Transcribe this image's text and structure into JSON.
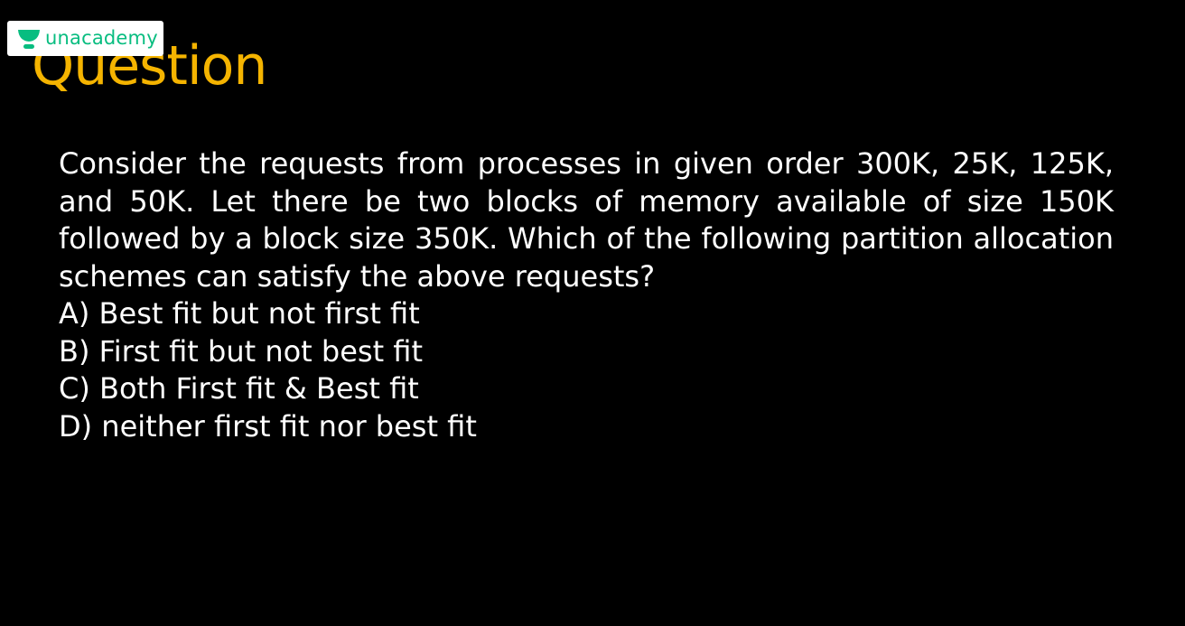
{
  "brand": {
    "logo_text": "unacademy",
    "logo_icon": "unacademy-logo-icon",
    "accent_color": "#08bd80"
  },
  "slide": {
    "title": "Question",
    "title_color": "#f5b400",
    "background_color": "#000000",
    "text_color": "#ffffff",
    "question": "Consider the requests from processes in given order 300K, 25K, 125K, and 50K. Let there be two blocks of memory available of size 150K followed by a block size 350K. Which of the following partition allocation schemes can satisfy the above requests?",
    "options": [
      "A) Best fit but not first fit",
      "B) First fit but not best fit",
      "C) Both First fit & Best fit",
      "D) neither first fit nor best fit"
    ]
  }
}
